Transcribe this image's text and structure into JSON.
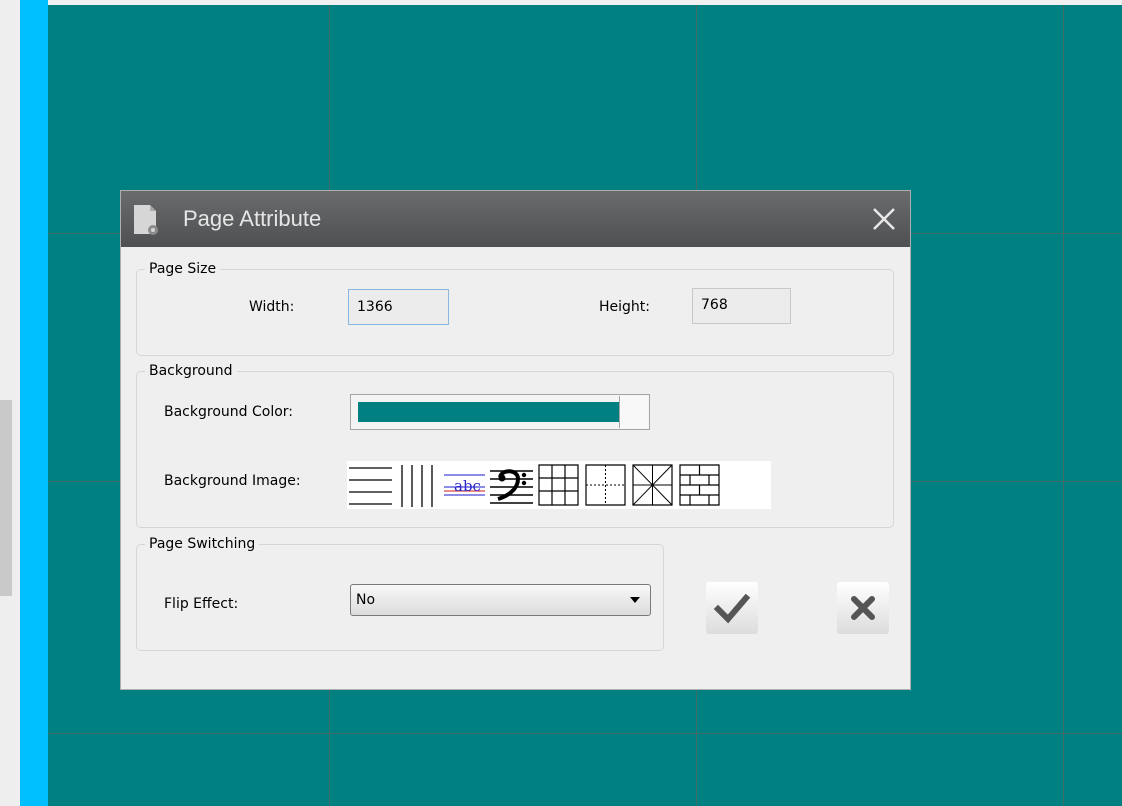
{
  "dialog": {
    "title": "Page Attribute",
    "icons": {
      "title": "page-settings-icon",
      "close": "close-icon"
    }
  },
  "page_size": {
    "group_label": "Page Size",
    "width_label": "Width:",
    "width_value": "1366",
    "height_label": "Height:",
    "height_value": "768"
  },
  "background": {
    "group_label": "Background",
    "color_label": "Background Color:",
    "color_value": "#008080",
    "image_label": "Background Image:",
    "images": [
      {
        "name": "horizontal-lines",
        "icon": "horizontal-lines-icon"
      },
      {
        "name": "vertical-lines",
        "icon": "vertical-lines-icon"
      },
      {
        "name": "text-lines",
        "icon": "abc-lines-icon",
        "text": "abc"
      },
      {
        "name": "music-staff",
        "icon": "bass-clef-staff-icon"
      },
      {
        "name": "grid",
        "icon": "grid-icon"
      },
      {
        "name": "cross-dashed",
        "icon": "dashed-cross-icon"
      },
      {
        "name": "star-grid",
        "icon": "star-grid-icon"
      },
      {
        "name": "brick",
        "icon": "brick-icon"
      }
    ]
  },
  "page_switching": {
    "group_label": "Page Switching",
    "flip_label": "Flip Effect:",
    "flip_value": "No"
  },
  "buttons": {
    "ok_icon": "checkmark-icon",
    "cancel_icon": "x-icon"
  },
  "colors": {
    "canvas": "#008080",
    "accent_bar": "#00bfff",
    "titlebar": "#5b5d5f"
  }
}
